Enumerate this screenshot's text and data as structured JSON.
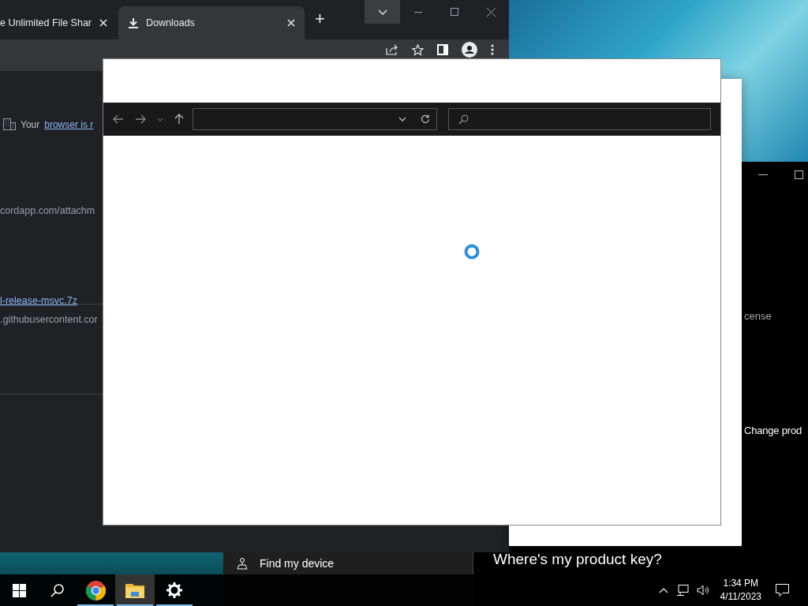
{
  "browser": {
    "tabs": [
      {
        "title": "e Unlimited File Shar",
        "selected": false
      },
      {
        "title": "Downloads",
        "selected": true
      }
    ],
    "new_tab": "+",
    "notice": {
      "text": "Your",
      "link": "browser is r"
    },
    "downloads": [
      {
        "url": "cordapp.com/attachm"
      },
      {
        "name": "l-release-msvc.7z",
        "url": ".githubusercontent.cor"
      }
    ]
  },
  "settings": {
    "nav": [
      {
        "label": "Find my device",
        "selected": false
      }
    ],
    "texts": [
      {
        "text": "cense",
        "kind": "caption"
      },
      {
        "text": "Change prod",
        "kind": "action"
      }
    ],
    "heading": "Where's my product key?"
  },
  "taskbar": {
    "apps": [
      {
        "kind": "chrome",
        "running": true,
        "selected": false
      },
      {
        "kind": "explorer",
        "running": true,
        "selected": true
      },
      {
        "kind": "settings",
        "running": true,
        "selected": false
      }
    ],
    "time": "1:34 PM",
    "date": "4/11/2023"
  }
}
